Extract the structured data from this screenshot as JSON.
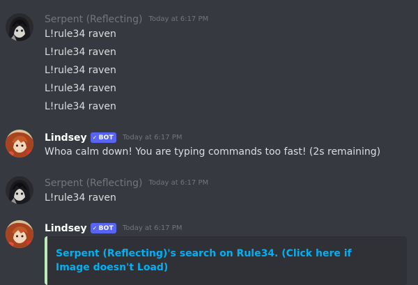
{
  "messages": [
    {
      "username": "Serpent (Reflecting)",
      "timestamp": "Today at 6:17 PM",
      "lines": [
        "L!rule34 raven",
        "L!rule34 raven",
        "L!rule34 raven",
        "L!rule34 raven",
        "L!rule34 raven"
      ]
    },
    {
      "username": "Lindsey",
      "badge": "BOT",
      "timestamp": "Today at 6:17 PM",
      "lines": [
        "Whoa calm down! You are typing commands too fast! (2s remaining)"
      ]
    },
    {
      "username": "Serpent (Reflecting)",
      "timestamp": "Today at 6:17 PM",
      "lines": [
        "L!rule34 raven"
      ]
    },
    {
      "username": "Lindsey",
      "badge": "BOT",
      "timestamp": "Today at 6:17 PM",
      "embed": {
        "title": "Serpent (Reflecting)'s search on Rule34. (Click here if Image doesn't Load)"
      }
    }
  ],
  "colors": {
    "background": "#36393f",
    "embed_background": "#2f3136",
    "embed_accent": "#bbecb6",
    "link": "#00b0f4",
    "bot_badge": "#5865f2",
    "muted_username": "#72767d",
    "message_text": "#dcddde"
  },
  "icons": {
    "verified": "verified-check-icon"
  }
}
